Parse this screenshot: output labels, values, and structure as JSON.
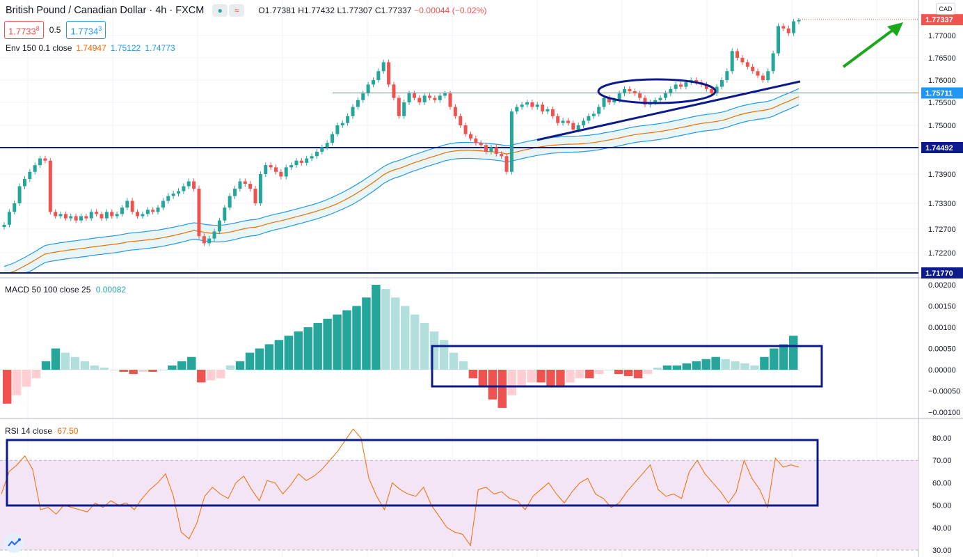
{
  "header": {
    "symbol": "British Pound / Canadian Dollar · 4h · FXCM",
    "ohlc_open": "O1.77381",
    "ohlc_high": "H1.77432",
    "ohlc_low": "L1.77307",
    "ohlc_close": "C1.77337",
    "ohlc_change": "−0.00044 (−0.02%)",
    "sell_price": "1.7733",
    "sell_sup": "8",
    "spread": "0.5",
    "buy_price": "1.7734",
    "buy_sup": "3",
    "indicator_label": "Env 150 0.1 close",
    "ind_v1": "1.74947",
    "ind_v2": "1.75122",
    "ind_v3": "1.74773"
  },
  "currency_button": "CAD",
  "macd": {
    "label": "MACD 50 100 close 25",
    "value": "0.00082"
  },
  "rsi": {
    "label": "RSI 14 close",
    "value": "67.50"
  },
  "colors": {
    "up": "#26a69a",
    "down": "#ef5350",
    "macd_up_strong": "#26a69a",
    "macd_up_weak": "#b2dfdb",
    "macd_down_strong": "#ef5350",
    "macd_down_weak": "#ffcdd2",
    "env_upper": "#2196f3",
    "env_mid": "#ef6c00",
    "env_fill": "#e0f2f1",
    "rsi_line": "#ef6c00",
    "rsi_band": "#f3e5f5",
    "annotation": "#0d1a8c",
    "arrow": "#1aa71a",
    "hline": "#0d1a8c"
  },
  "chart_data": [
    {
      "type": "candlestick",
      "price_axis_ticks": [
        "1.77000",
        "1.76500",
        "1.76000",
        "1.75500",
        "1.75000",
        "1.73900",
        "1.73300",
        "1.72700",
        "1.72200"
      ],
      "price_axis_tick_values": [
        1.77,
        1.765,
        1.76,
        1.755,
        1.75,
        1.739,
        1.733,
        1.727,
        1.722
      ],
      "price_labels": [
        {
          "text": "1.77337",
          "value": 1.77337,
          "kind": "current"
        },
        {
          "text": "1.75711",
          "value": 1.75711,
          "kind": "level-thin"
        },
        {
          "text": "1.74492",
          "value": 1.74492,
          "kind": "level"
        },
        {
          "text": "1.71770",
          "value": 1.7177,
          "kind": "level"
        }
      ],
      "candles_close": [
        1.728,
        1.731,
        1.733,
        1.7365,
        1.738,
        1.7395,
        1.741,
        1.7425,
        1.742,
        1.731,
        1.73,
        1.7305,
        1.7295,
        1.73,
        1.729,
        1.73,
        1.7295,
        1.731,
        1.7305,
        1.7295,
        1.731,
        1.73,
        1.7305,
        1.732,
        1.7335,
        1.731,
        1.73,
        1.7305,
        1.7315,
        1.731,
        1.732,
        1.7335,
        1.7345,
        1.735,
        1.7355,
        1.7365,
        1.7375,
        1.736,
        1.7255,
        1.724,
        1.725,
        1.7265,
        1.729,
        1.732,
        1.7345,
        1.736,
        1.7375,
        1.737,
        1.736,
        1.733,
        1.739,
        1.741,
        1.7405,
        1.7395,
        1.7385,
        1.7405,
        1.741,
        1.742,
        1.7415,
        1.7425,
        1.743,
        1.744,
        1.745,
        1.746,
        1.748,
        1.75,
        1.7505,
        1.752,
        1.754,
        1.7555,
        1.757,
        1.759,
        1.76,
        1.762,
        1.764,
        1.759,
        1.756,
        1.752,
        1.755,
        1.757,
        1.756,
        1.755,
        1.7565,
        1.756,
        1.7555,
        1.7565,
        1.757,
        1.754,
        1.752,
        1.75,
        1.748,
        1.747,
        1.746,
        1.7455,
        1.744,
        1.745,
        1.7435,
        1.743,
        1.7395,
        1.753,
        1.754,
        1.7545,
        1.755,
        1.754,
        1.7545,
        1.753,
        1.7535,
        1.752,
        1.7505,
        1.751,
        1.7505,
        1.749,
        1.75,
        1.751,
        1.752,
        1.7525,
        1.754,
        1.756,
        1.755,
        1.7555,
        1.757,
        1.758,
        1.7575,
        1.757,
        1.756,
        1.7545,
        1.755,
        1.7555,
        1.756,
        1.757,
        1.758,
        1.759,
        1.7585,
        1.7595,
        1.76,
        1.7595,
        1.759,
        1.758,
        1.757,
        1.7585,
        1.76,
        1.762,
        1.7665,
        1.765,
        1.764,
        1.763,
        1.762,
        1.761,
        1.76,
        1.762,
        1.766,
        1.772,
        1.7715,
        1.7705,
        1.773,
        1.7733
      ]
    },
    {
      "type": "bar",
      "name": "MACD 50 100 close 25",
      "axis_ticks": [
        "0.00200",
        "0.00150",
        "0.00100",
        "0.00050",
        "0.00000",
        "−0.00050",
        "−0.00100"
      ],
      "axis_tick_values": [
        0.002,
        0.0015,
        0.001,
        0.0005,
        0,
        -0.0005,
        -0.001
      ],
      "values": [
        -0.0008,
        -0.0006,
        -0.0004,
        -0.0002,
        0.0002,
        0.0005,
        0.0004,
        0.0003,
        0.0002,
        0.0001,
        5e-05,
        0,
        -5e-05,
        -0.0001,
        -5e-05,
        -5e-05,
        0,
        0.0001,
        0.0002,
        0.0003,
        -0.0003,
        -0.00025,
        -0.0002,
        0.0001,
        0.0002,
        0.0004,
        0.0005,
        0.0006,
        0.0007,
        0.0008,
        0.0009,
        0.001,
        0.0011,
        0.0012,
        0.0013,
        0.0014,
        0.0015,
        0.0017,
        0.002,
        0.0019,
        0.0017,
        0.0015,
        0.0013,
        0.0011,
        0.0009,
        0.0007,
        0.0004,
        0.0002,
        -0.0002,
        -0.0004,
        -0.0007,
        -0.0009,
        -0.0006,
        -0.0004,
        -0.0003,
        -0.0003,
        -0.0004,
        -0.0004,
        -0.0003,
        -0.0002,
        -0.0002,
        -0.0001,
        0,
        -0.0001,
        -0.00015,
        -0.0002,
        -0.0001,
        5e-05,
        0.0001,
        0.0001,
        0.00015,
        0.0002,
        0.00025,
        0.0003,
        0.00025,
        0.0002,
        0.00015,
        0.0001,
        0.0003,
        0.0005,
        0.0006,
        0.0008
      ]
    },
    {
      "type": "line",
      "name": "RSI 14 close",
      "axis_ticks": [
        "80.00",
        "70.00",
        "60.00",
        "50.00",
        "40.00",
        "30.00"
      ],
      "axis_tick_values": [
        80,
        70,
        60,
        50,
        40,
        30
      ],
      "band": [
        30,
        70
      ],
      "values": [
        55,
        65,
        68,
        72,
        66,
        48,
        49,
        46,
        50,
        49,
        48,
        47,
        51,
        49,
        52,
        50,
        51,
        48,
        53,
        57,
        60,
        64,
        54,
        38,
        35,
        42,
        54,
        58,
        55,
        53,
        60,
        63,
        57,
        52,
        61,
        60,
        55,
        59,
        64,
        61,
        63,
        66,
        70,
        74,
        79,
        84,
        80,
        62,
        54,
        48,
        60,
        57,
        55,
        54,
        58,
        50,
        45,
        40,
        38,
        37,
        32,
        57,
        58,
        55,
        56,
        53,
        52,
        48,
        54,
        57,
        60,
        55,
        51,
        56,
        60,
        62,
        55,
        53,
        49,
        51,
        56,
        60,
        64,
        68,
        57,
        54,
        55,
        53,
        65,
        70,
        64,
        60,
        56,
        51,
        56,
        70,
        62,
        57,
        49,
        71,
        67,
        68,
        67
      ]
    }
  ]
}
